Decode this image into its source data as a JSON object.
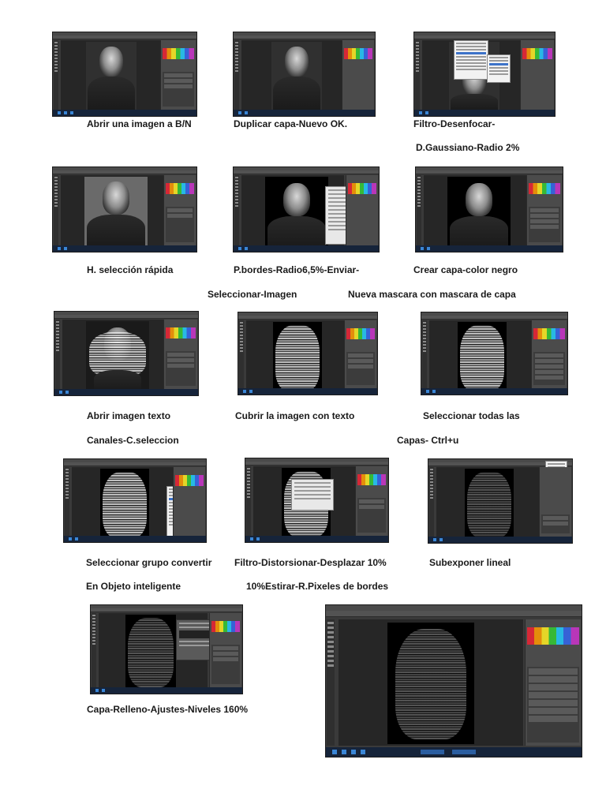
{
  "captions": {
    "s1": "Abrir una imagen a B/N",
    "s2": "Duplicar capa-Nuevo OK.",
    "s3a": "Filtro-Desenfocar-",
    "s3b": "D.Gaussiano-Radio 2%",
    "s4": "H. selección rápida",
    "s5a": "P.bordes-Radio6,5%-Enviar-",
    "s5b": "Seleccionar-Imagen",
    "s6a": "Crear capa-color negro",
    "s6b": "Nueva mascara con mascara de capa",
    "s7a": "Abrir imagen texto",
    "s7b": "Canales-C.seleccion",
    "s8": "Cubrir la imagen con texto",
    "s9a": "Seleccionar todas las",
    "s9b": "Capas-  Ctrl+u",
    "s10a": "Seleccionar grupo convertir",
    "s10b": "En Objeto inteligente",
    "s11a": "Filtro-Distorsionar-Desplazar 10%",
    "s11b": "10%Estirar-R.Pixeles de bordes",
    "s12": "Subexponer lineal",
    "s13": "Capa-Relleno-Ajustes-Niveles 160%"
  },
  "icons": {
    "toolbar": "tool-icons",
    "taskbar": "windows-taskbar",
    "swatches": "color-swatches"
  }
}
